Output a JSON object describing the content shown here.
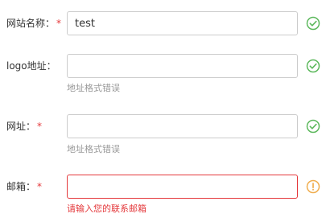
{
  "form": {
    "fields": [
      {
        "label": "网站名称：",
        "required_mark": "*",
        "value": "test",
        "hint": "",
        "status": "valid"
      },
      {
        "label": "logo地址：",
        "required_mark": "",
        "value": "",
        "hint": "地址格式错误",
        "status": "valid"
      },
      {
        "label": "网址：",
        "required_mark": "*",
        "value": "",
        "hint": "地址格式错误",
        "status": "valid"
      },
      {
        "label": "邮箱：",
        "required_mark": "*",
        "value": "",
        "hint": "请输入您的联系邮箱",
        "status": "error"
      }
    ]
  },
  "icons": {
    "valid": "check-circle-icon",
    "error": "exclamation-circle-icon"
  },
  "colors": {
    "valid": "#5cb85c",
    "error_icon": "#f0ad4e",
    "error_text": "#e4393c",
    "required": "#e4393c",
    "hint_text": "#999999"
  }
}
